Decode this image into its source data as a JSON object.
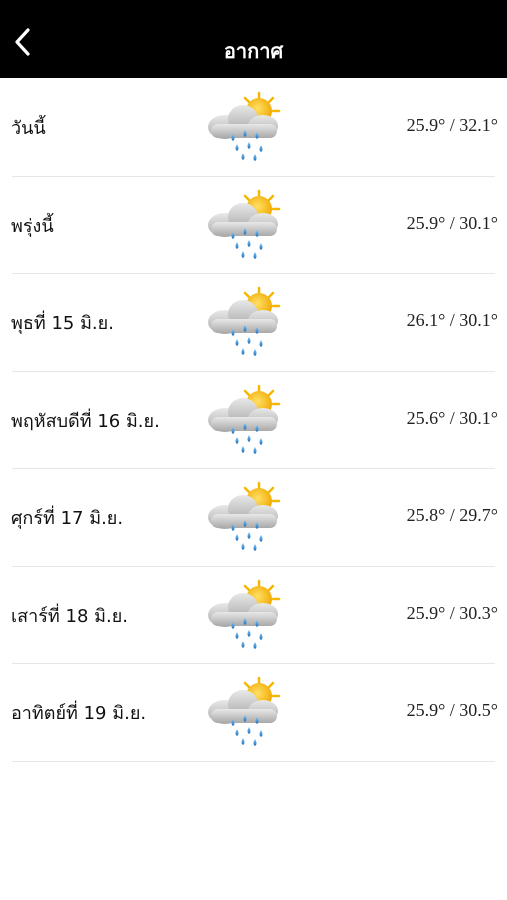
{
  "header": {
    "title": "อากาศ"
  },
  "colors": {
    "header_bg": "#000000",
    "sun": "#f5b800",
    "cloud": "#c9c9c9",
    "rain": "#2a8fd6"
  },
  "forecast": [
    {
      "day": "วันนี้",
      "temp": "25.9° / 32.1°",
      "icon": "sun-cloud-rain-icon"
    },
    {
      "day": "พรุ่งนี้",
      "temp": "25.9° / 30.1°",
      "icon": "sun-cloud-rain-icon"
    },
    {
      "day": "พุธที่ 15 มิ.ย.",
      "temp": "26.1° / 30.1°",
      "icon": "sun-cloud-rain-icon"
    },
    {
      "day": "พฤหัสบดีที่ 16 มิ.ย.",
      "temp": "25.6° / 30.1°",
      "icon": "sun-cloud-rain-icon"
    },
    {
      "day": "ศุกร์ที่ 17 มิ.ย.",
      "temp": "25.8° / 29.7°",
      "icon": "sun-cloud-rain-icon"
    },
    {
      "day": "เสาร์ที่ 18 มิ.ย.",
      "temp": "25.9° / 30.3°",
      "icon": "sun-cloud-rain-icon"
    },
    {
      "day": "อาทิตย์ที่ 19 มิ.ย.",
      "temp": "25.9° / 30.5°",
      "icon": "sun-cloud-rain-icon"
    }
  ]
}
